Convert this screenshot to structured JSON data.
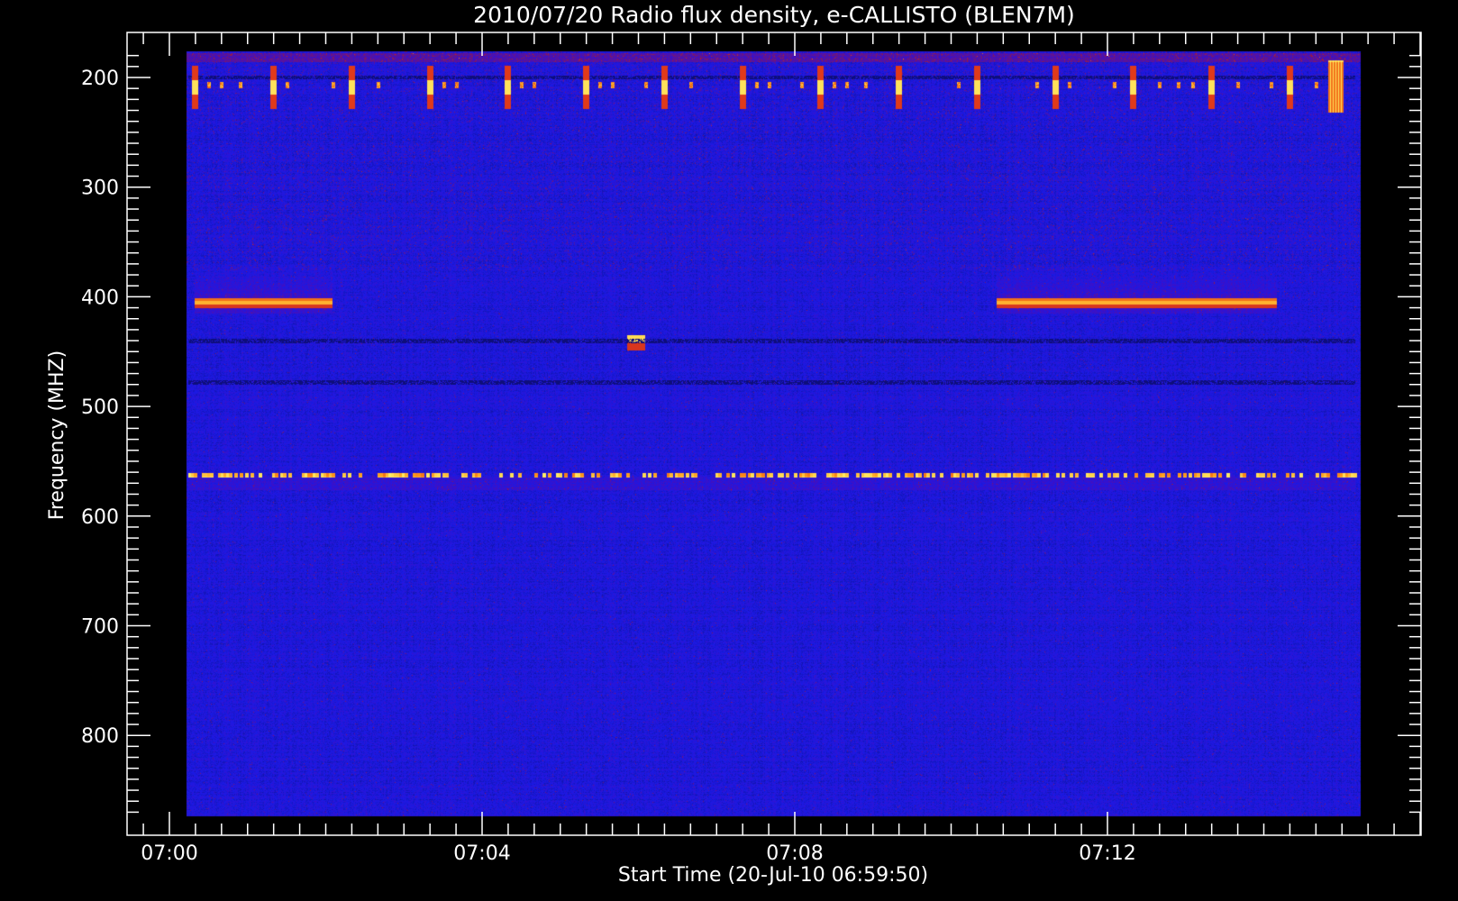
{
  "chart_data": {
    "type": "heatmap",
    "title": "2010/07/20  Radio flux density, e-CALLISTO (BLEN7M)",
    "xlabel": "Start Time (20-Jul-10 06:59:50)",
    "ylabel": "Frequency (MHZ)",
    "x_range": [
      "07:00:00",
      "07:15:10"
    ],
    "y_range_mhz": [
      175,
      870
    ],
    "x_ticks": [
      "07:00",
      "07:04",
      "07:08",
      "07:12"
    ],
    "y_ticks": [
      200,
      300,
      400,
      500,
      600,
      700,
      800
    ],
    "y_inverted": true,
    "colormap": [
      "#0b0b5c",
      "#1a1ae6",
      "#3b10c9",
      "#9c1a3a",
      "#e03a1a",
      "#ff9a1a",
      "#ffee66"
    ],
    "background_color": "#1a1ae6",
    "features": [
      {
        "kind": "horizontal-band",
        "freq_mhz": 405,
        "start": "07:00:20",
        "end": "07:02:05",
        "intensity": "high"
      },
      {
        "kind": "horizontal-band",
        "freq_mhz": 405,
        "start": "07:10:35",
        "end": "07:14:10",
        "intensity": "high"
      },
      {
        "kind": "spot",
        "freq_mhz": 442,
        "start": "07:05:52",
        "end": "07:06:05",
        "intensity": "high"
      },
      {
        "kind": "dotted-line",
        "freq_mhz": 563,
        "start": "07:00:15",
        "end": "07:15:10",
        "intensity": "high"
      },
      {
        "kind": "dark-line",
        "freq_mhz": 478,
        "start": "07:00:15",
        "end": "07:15:10"
      },
      {
        "kind": "dark-line",
        "freq_mhz": 440,
        "start": "07:00:15",
        "end": "07:15:10"
      },
      {
        "kind": "dark-line",
        "freq_mhz": 200,
        "start": "07:00:15",
        "end": "07:15:10"
      },
      {
        "kind": "periodic-bursts",
        "freq_mhz_range": [
          190,
          228
        ],
        "period_s": 60,
        "start": "07:00:20",
        "end": "07:14:55",
        "intensity": "high"
      }
    ]
  }
}
